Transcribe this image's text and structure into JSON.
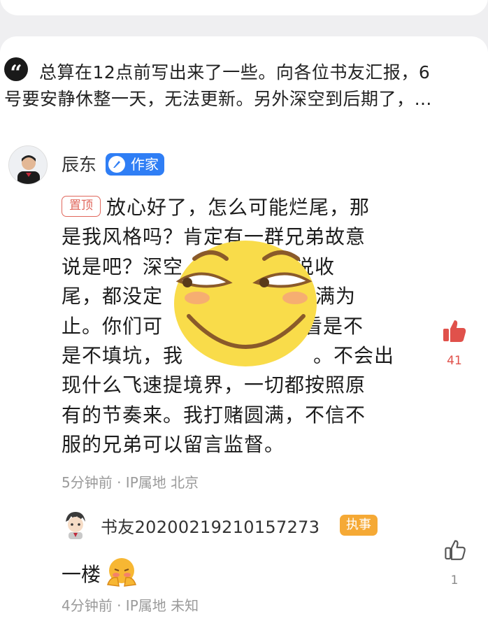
{
  "quote": {
    "icon": "quote-icon",
    "line1": "总算在12点前写出来了一些。向各位书友汇报，6",
    "line2": "号要安静休整一天，无法更新。另外深空到后期了，…"
  },
  "comment": {
    "author": "辰东",
    "author_badge": "作家",
    "pin_tag": "置顶",
    "lines": [
      "放心好了，怎么可能烂尾，那",
      "是我风格吗？肯定有一群兄弟故意",
      "说是吧？深空",
      "尾，都没定",
      "止。你们可",
      "是不填坑，我",
      "现什么飞速提境界，一切都按照原",
      "有的节奏来。我打赌圆满，不信不",
      "服的兄弟可以留言监督。"
    ],
    "line_tails": [
      "",
      "",
      "我说收",
      "到完满为",
      "看是不",
      "。不会出",
      "",
      "",
      ""
    ],
    "meta": "5分钟前 · IP属地 北京",
    "like_count": "41",
    "like_icon": "thumbs-up-filled-icon",
    "like_color": "#e0514b"
  },
  "reply": {
    "author": "书友20200219210157273",
    "badge": "执事",
    "text": "一楼",
    "meta": "4分钟前 · IP属地 未知",
    "like_count": "1",
    "like_icon": "thumbs-up-outline-icon"
  },
  "colors": {
    "author_badge": "#2f7ef5",
    "pin_tag": "#e0675c",
    "reply_badge": "#f5a935",
    "emoji_face": "#f9dc4a"
  }
}
